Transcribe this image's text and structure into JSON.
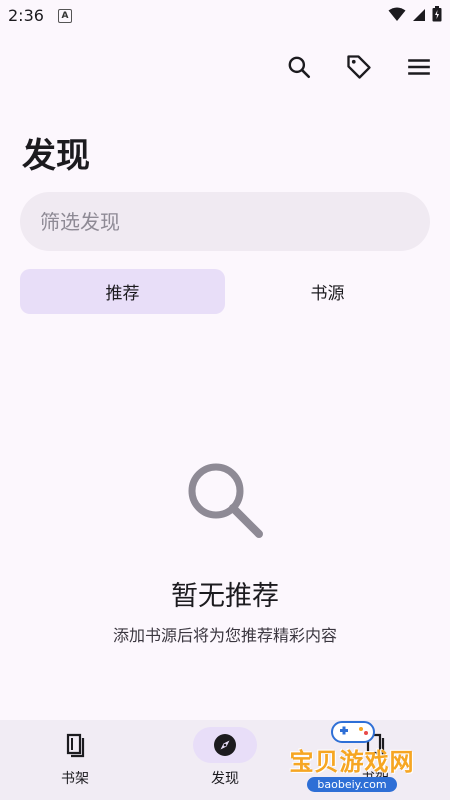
{
  "status_bar": {
    "time": "2:36",
    "notification_icon": "A"
  },
  "toolbar": {
    "icons": [
      "search-icon",
      "tag-icon",
      "menu-icon"
    ]
  },
  "page": {
    "title": "发现"
  },
  "search": {
    "placeholder": "筛选发现",
    "value": ""
  },
  "tabs": [
    {
      "label": "推荐",
      "active": true
    },
    {
      "label": "书源",
      "active": false
    }
  ],
  "empty_state": {
    "icon": "search-icon",
    "title": "暂无推荐",
    "subtitle": "添加书源后将为您推荐精彩内容"
  },
  "bottom_nav": [
    {
      "label": "书架",
      "icon": "book-icon",
      "active": false
    },
    {
      "label": "发现",
      "icon": "compass-icon",
      "active": true
    },
    {
      "label": "书架",
      "icon": "book-icon",
      "active": false
    }
  ],
  "watermark": {
    "title": "宝贝游戏网",
    "url": "baobeiy.com"
  },
  "colors": {
    "background": "#FCF7FD",
    "accent_container": "#E8DEF8",
    "search_bg": "#F0EAF2",
    "nav_bg": "#F1ECF4",
    "icon_gray": "#8E8A95"
  }
}
